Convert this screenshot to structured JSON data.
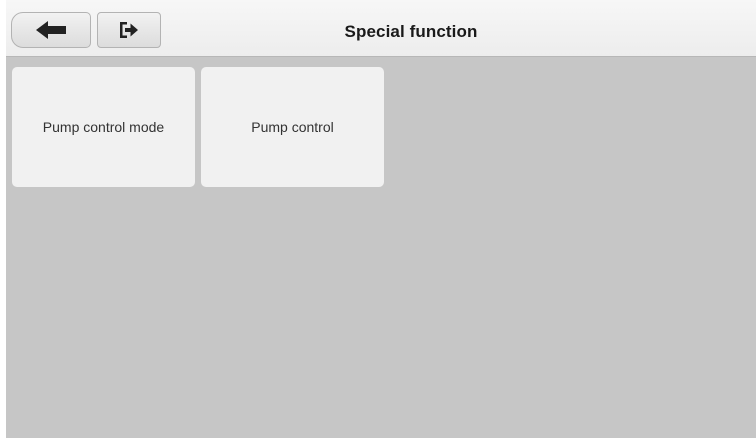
{
  "header": {
    "title": "Special function",
    "back_icon": "back-arrow-icon",
    "exit_icon": "exit-icon"
  },
  "functions": [
    {
      "label": "Pump control mode"
    },
    {
      "label": "Pump control"
    }
  ],
  "colors": {
    "background": "#c6c6c6",
    "header": "#efefef",
    "tile": "#f1f1f1",
    "icon": "#222222"
  }
}
